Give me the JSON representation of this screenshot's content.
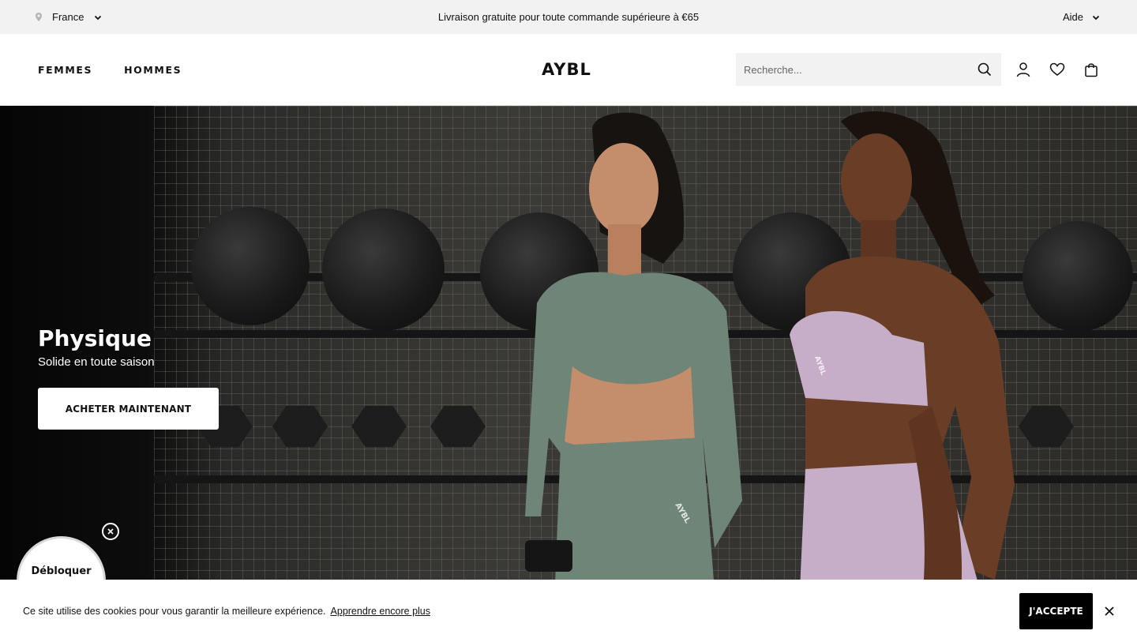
{
  "topbar": {
    "country": "France",
    "announcement": "Livraison gratuite pour toute commande supérieure à €65",
    "help": "Aide"
  },
  "header": {
    "nav": [
      "FEMMES",
      "HOMMES"
    ],
    "logo": "AYBL",
    "search_placeholder": "Recherche...",
    "icons": [
      "search-icon",
      "account-icon",
      "wishlist-heart-icon",
      "shopping-bag-icon"
    ]
  },
  "hero": {
    "title": "Physique",
    "subtitle": "Solide en toute saison",
    "cta": "ACHETER MAINTENANT",
    "colors": {
      "top_green": "#6e8577",
      "bra_lilac": "#c7aec8"
    }
  },
  "discount_widget": {
    "label": "Débloquer"
  },
  "cookie": {
    "text": "Ce site utilise des cookies pour vous garantir la meilleure expérience.",
    "link": "Apprendre encore plus",
    "accept": "J'ACCEPTE"
  }
}
